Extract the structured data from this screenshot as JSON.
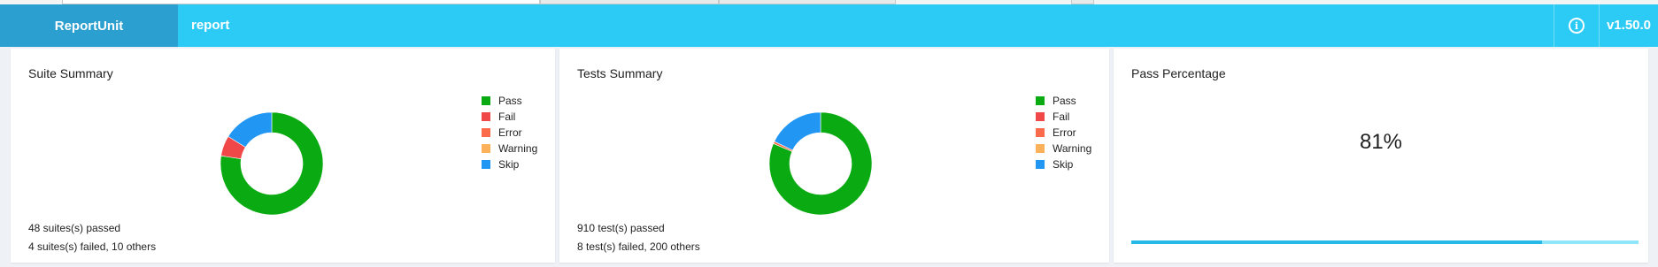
{
  "navbar": {
    "brand": "ReportUnit",
    "title": "report",
    "version": "v1.50.0"
  },
  "legend_items": [
    {
      "label": "Pass",
      "color": "#0aaa12"
    },
    {
      "label": "Fail",
      "color": "#f04848"
    },
    {
      "label": "Error",
      "color": "#fb6a4a"
    },
    {
      "label": "Warning",
      "color": "#fbb159"
    },
    {
      "label": "Skip",
      "color": "#2196f3"
    }
  ],
  "suite_summary": {
    "title": "Suite Summary",
    "line1": "48 suites(s) passed",
    "line2": "4 suites(s) failed, 10 others",
    "chart_data": {
      "type": "pie",
      "categories": [
        "Pass",
        "Fail",
        "Error",
        "Warning",
        "Skip"
      ],
      "values": [
        48,
        4,
        0,
        0,
        10
      ]
    }
  },
  "tests_summary": {
    "title": "Tests Summary",
    "line1": "910 test(s) passed",
    "line2": "8 test(s) failed, 200 others",
    "chart_data": {
      "type": "pie",
      "categories": [
        "Pass",
        "Fail",
        "Error",
        "Warning",
        "Skip"
      ],
      "values": [
        910,
        0,
        8,
        0,
        200
      ]
    }
  },
  "pass_percentage": {
    "title": "Pass Percentage",
    "value": "81%",
    "fraction": 0.81
  }
}
